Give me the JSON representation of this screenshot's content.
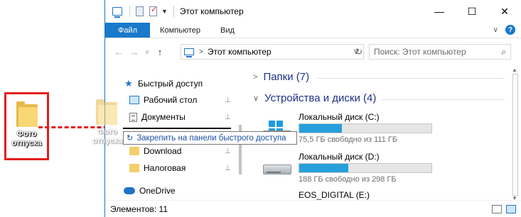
{
  "desktop": {
    "folder_label_line1": "Фото",
    "folder_label_line2": "отпуска",
    "ghost_label_line1": "Фото",
    "ghost_label_line2": "отпуска"
  },
  "window": {
    "title": "Этот компьютер",
    "controls": {
      "minimize": "—",
      "maximize": "☐",
      "close": "✕"
    },
    "ribbon": {
      "tabs": [
        "Файл",
        "Компьютер",
        "Вид"
      ],
      "collapse": "∨",
      "help": "?"
    },
    "nav": {
      "back": "←",
      "forward": "→",
      "history": "∨",
      "up": "↑",
      "address": "Этот компьютер",
      "address_sep": ">",
      "address_drop": "∨",
      "refresh": "↻",
      "search_placeholder": "Поиск: Этот компьютер",
      "search_icon": "⌕"
    },
    "sidebar": {
      "items": [
        {
          "label": "Быстрый доступ",
          "icon": "star-icon"
        },
        {
          "label": "Рабочий стол",
          "icon": "desktop-icon",
          "pinned": true
        },
        {
          "label": "Документы",
          "icon": "documents-icon",
          "pinned": true
        },
        {
          "label": "Download",
          "icon": "folder-icon",
          "pinned": true
        },
        {
          "label": "Налоговая",
          "icon": "folder-icon",
          "pinned": true
        },
        {
          "label": "OneDrive",
          "icon": "cloud-icon"
        }
      ],
      "pin_glyph": "📌"
    },
    "tooltip": {
      "text": "Закрепить на панели быстрого доступа",
      "icon": "↻"
    },
    "content": {
      "groups": [
        {
          "label": "Папки (7)",
          "expanded": false,
          "chev": ">"
        },
        {
          "label": "Устройства и диски (4)",
          "expanded": true,
          "chev": "∨"
        }
      ],
      "drives": [
        {
          "name": "Локальный диск (C:)",
          "free_text": "75,5 ГБ свободно из 111 ГБ",
          "used_fraction": 0.32,
          "icon": "windows-drive-icon"
        },
        {
          "name": "Локальный диск (D:)",
          "free_text": "188 ГБ свободно из 298 ГБ",
          "used_fraction": 0.37,
          "icon": "hdd-icon"
        },
        {
          "name": "EOS_DIGITAL (E:)",
          "icon": "removable-drive-icon"
        }
      ]
    },
    "status": {
      "items_text": "Элементов: 11"
    },
    "colors": {
      "accent": "#1979ca",
      "drive_fill": "#26a0da",
      "drag_arrow": "#e21e1e"
    }
  }
}
